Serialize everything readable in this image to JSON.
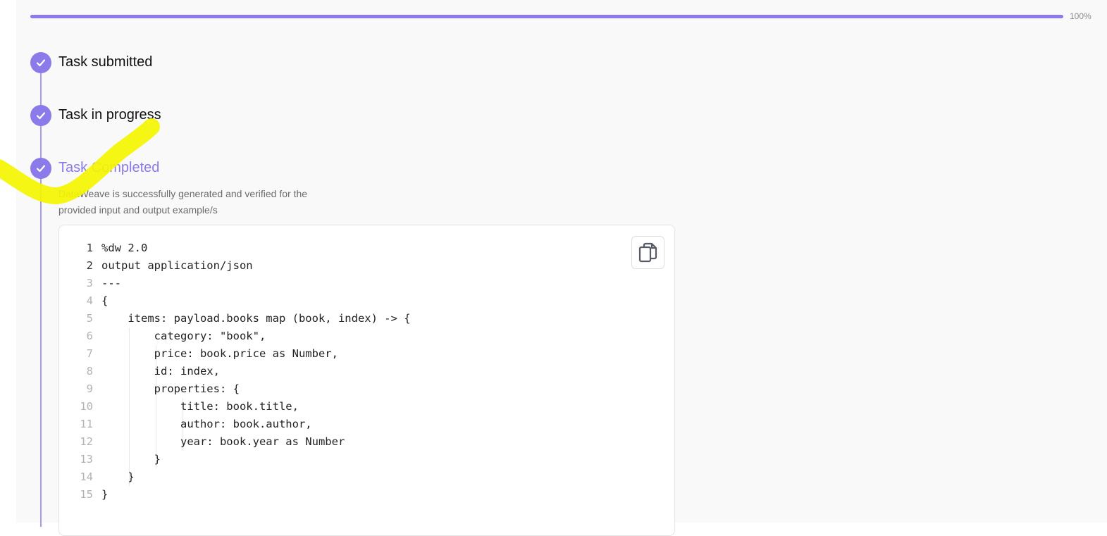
{
  "progress": {
    "value": 1.0,
    "label": "100%",
    "color": "#8b7bea"
  },
  "steps": [
    {
      "title": "Task submitted",
      "status": "complete",
      "icon": "check-icon"
    },
    {
      "title": "Task in progress",
      "status": "complete",
      "icon": "check-icon"
    },
    {
      "title": "Task Completed",
      "status": "complete",
      "icon": "check-icon",
      "description": "DataWeave is successfully generated and verified for the provided input and output example/s"
    }
  ],
  "code": {
    "copy_icon": "copy-icon",
    "lines": [
      {
        "num": "1",
        "text": "%dw 2.0"
      },
      {
        "num": "2",
        "text": "output application/json"
      },
      {
        "num": "3",
        "text": "---"
      },
      {
        "num": "4",
        "text": "{"
      },
      {
        "num": "5",
        "text": "    items: payload.books map (book, index) -> {"
      },
      {
        "num": "6",
        "text": "        category: \"book\","
      },
      {
        "num": "7",
        "text": "        price: book.price as Number,"
      },
      {
        "num": "8",
        "text": "        id: index,"
      },
      {
        "num": "9",
        "text": "        properties: {"
      },
      {
        "num": "10",
        "text": "            title: book.title,"
      },
      {
        "num": "11",
        "text": "            author: book.author,"
      },
      {
        "num": "12",
        "text": "            year: book.year as Number"
      },
      {
        "num": "13",
        "text": "        }"
      },
      {
        "num": "14",
        "text": "    }"
      },
      {
        "num": "15",
        "text": "}"
      }
    ]
  },
  "colors": {
    "accent": "#8b7bea",
    "highlight": "#f5f500"
  }
}
